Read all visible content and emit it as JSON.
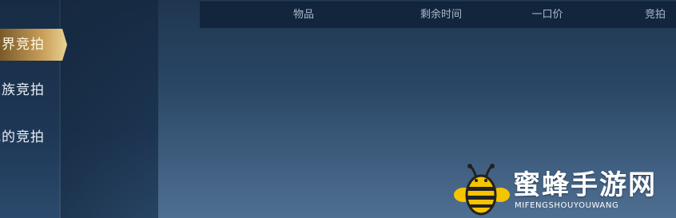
{
  "sidebar": {
    "tabs": [
      {
        "label": "世界竞拍",
        "active": true
      },
      {
        "label": "家族竞拍",
        "active": false
      },
      {
        "label": "我的竞拍",
        "active": false
      }
    ]
  },
  "table_header": {
    "columns": [
      "物品",
      "剩余时间",
      "一口价",
      "竞拍"
    ]
  },
  "watermark": {
    "title": "蜜蜂手游网",
    "subtitle": "MIFENGSHOUYOUWANG",
    "icon": "bee-logo-icon"
  },
  "colors": {
    "active_tab": "#c9a05a",
    "header_bg": "#12253c",
    "bee_yellow": "#f5c400"
  }
}
